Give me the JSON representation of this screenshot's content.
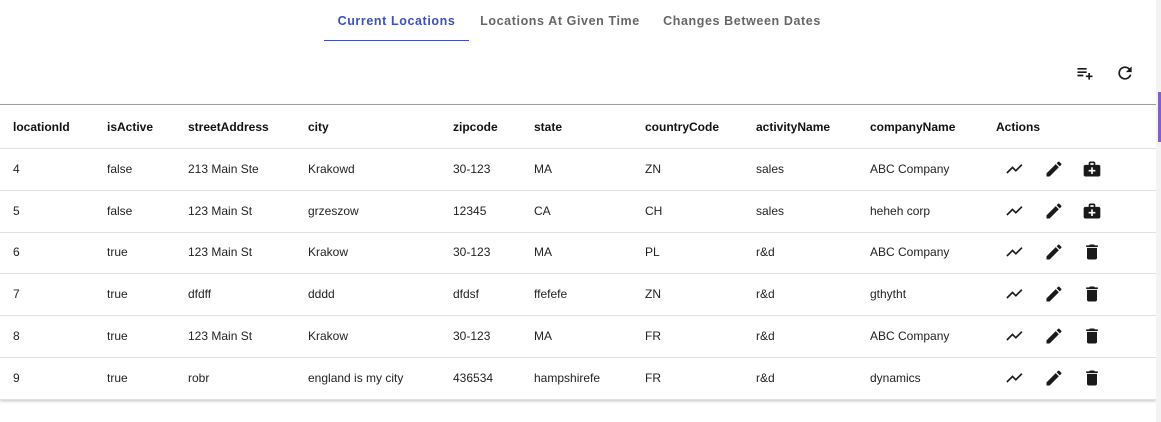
{
  "tabs": [
    {
      "label": "Current Locations",
      "active": true
    },
    {
      "label": "Locations At Given Time",
      "active": false
    },
    {
      "label": "Changes Between Dates",
      "active": false
    }
  ],
  "toolbar": {
    "add_icon": "playlist-add-icon",
    "refresh_icon": "refresh-icon"
  },
  "table": {
    "columns": [
      "locationId",
      "isActive",
      "streetAddress",
      "city",
      "zipcode",
      "state",
      "countryCode",
      "activityName",
      "companyName",
      "Actions"
    ],
    "rows": [
      {
        "cells": [
          "4",
          "false",
          "213 Main Ste",
          "Krakowd",
          "30-123",
          "MA",
          "ZN",
          "sales",
          "ABC Company"
        ],
        "actions": [
          "trend-icon",
          "edit-icon",
          "restore-icon"
        ]
      },
      {
        "cells": [
          "5",
          "false",
          "123 Main St",
          "grzeszow",
          "12345",
          "CA",
          "CH",
          "sales",
          "heheh corp"
        ],
        "actions": [
          "trend-icon",
          "edit-icon",
          "restore-icon"
        ]
      },
      {
        "cells": [
          "6",
          "true",
          "123 Main St",
          "Krakow",
          "30-123",
          "MA",
          "PL",
          "r&d",
          "ABC Company"
        ],
        "actions": [
          "trend-icon",
          "edit-icon",
          "delete-icon"
        ]
      },
      {
        "cells": [
          "7",
          "true",
          "dfdff",
          "dddd",
          "dfdsf",
          "ffefefe",
          "ZN",
          "r&d",
          "gthytht"
        ],
        "actions": [
          "trend-icon",
          "edit-icon",
          "delete-icon"
        ]
      },
      {
        "cells": [
          "8",
          "true",
          "123 Main St",
          "Krakow",
          "30-123",
          "MA",
          "FR",
          "r&d",
          "ABC Company"
        ],
        "actions": [
          "trend-icon",
          "edit-icon",
          "delete-icon"
        ]
      },
      {
        "cells": [
          "9",
          "true",
          "robr",
          "england is my city",
          "436534",
          "hampshirefe",
          "FR",
          "r&d",
          "dynamics"
        ],
        "actions": [
          "trend-icon",
          "edit-icon",
          "delete-icon"
        ]
      }
    ]
  },
  "colors": {
    "accent": "#3f51b5",
    "icon": "#1a1a1a"
  }
}
